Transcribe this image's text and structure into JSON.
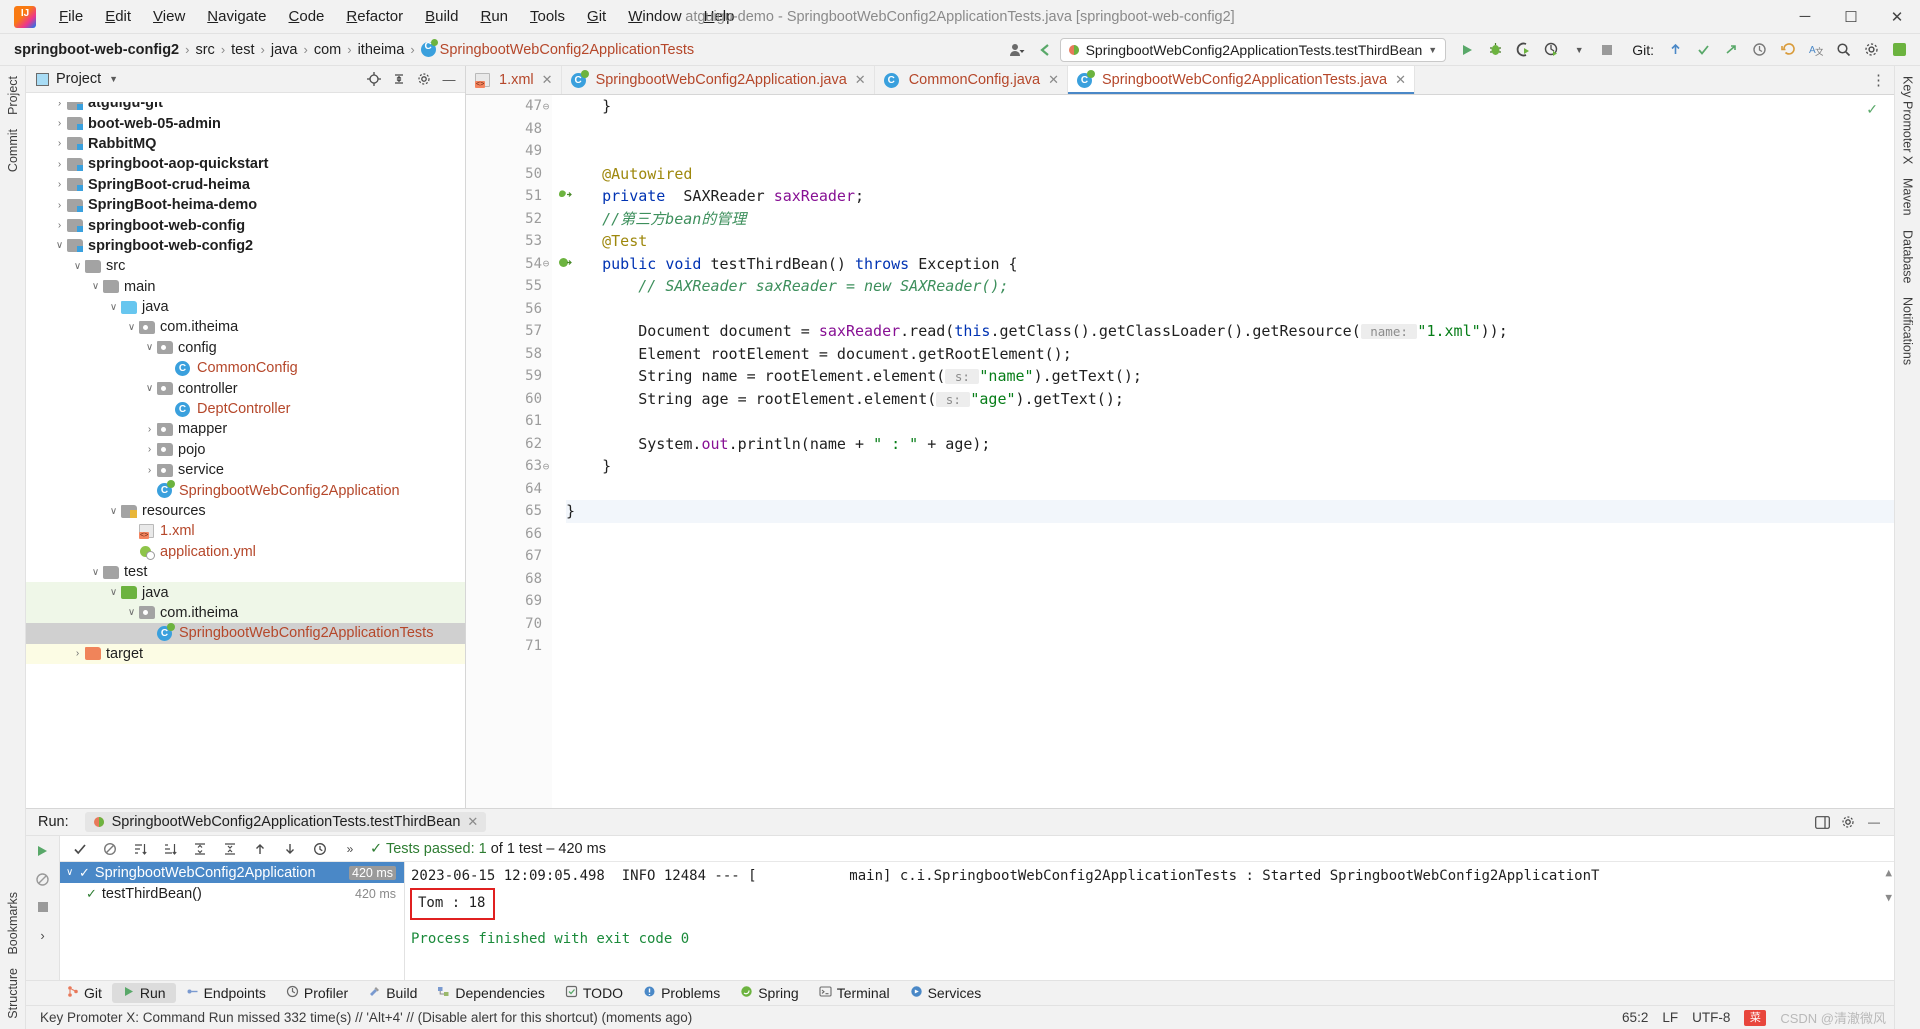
{
  "titlebar": {
    "window_title": "atguigu-demo - SpringbootWebConfig2ApplicationTests.java [springboot-web-config2]",
    "menus": [
      "File",
      "Edit",
      "View",
      "Navigate",
      "Code",
      "Refactor",
      "Build",
      "Run",
      "Tools",
      "Git",
      "Window",
      "Help"
    ],
    "minimize": "─",
    "maximize": "☐",
    "close": "✕"
  },
  "navbar": {
    "breadcrumb": [
      "springboot-web-config2",
      "src",
      "test",
      "java",
      "com",
      "itheima",
      "SpringbootWebConfig2ApplicationTests"
    ],
    "separator": "›",
    "run_config": "SpringbootWebConfig2ApplicationTests.testThirdBean",
    "git_label": "Git:",
    "icons": {
      "avatar": "user-icon",
      "back": "back-arrow-icon",
      "run": "run-icon",
      "debug": "debug-icon",
      "run_coverage": "run-with-coverage-icon",
      "profiler": "profiler-icon",
      "stop": "stop-icon",
      "update": "git-update-icon",
      "commit": "git-commit-icon",
      "push": "git-push-icon",
      "history": "history-icon",
      "rollback": "rollback-icon",
      "translate": "translate-icon",
      "search": "search-icon",
      "settings": "settings-icon",
      "ide": "ide-icon"
    }
  },
  "left_tool_strip": {
    "top": [
      "Project",
      "Commit"
    ],
    "bottom": [
      "Bookmarks",
      "Structure"
    ]
  },
  "right_tool_strip": {
    "top": [
      "Key Promoter X",
      "Maven",
      "Database",
      "Notifications"
    ]
  },
  "project_panel": {
    "title": "Project",
    "tree": [
      {
        "label": "atguigu-git",
        "depth": 1,
        "arrow": "›",
        "icon": "module",
        "bold": true,
        "clipped": true
      },
      {
        "label": "boot-web-05-admin",
        "depth": 1,
        "arrow": "›",
        "icon": "module",
        "bold": true
      },
      {
        "label": "RabbitMQ",
        "depth": 1,
        "arrow": "›",
        "icon": "module",
        "bold": true
      },
      {
        "label": "springboot-aop-quickstart",
        "depth": 1,
        "arrow": "›",
        "icon": "module",
        "bold": true
      },
      {
        "label": "SpringBoot-crud-heima",
        "depth": 1,
        "arrow": "›",
        "icon": "module",
        "bold": true
      },
      {
        "label": "SpringBoot-heima-demo",
        "depth": 1,
        "arrow": "›",
        "icon": "module",
        "bold": true
      },
      {
        "label": "springboot-web-config",
        "depth": 1,
        "arrow": "›",
        "icon": "module",
        "bold": true
      },
      {
        "label": "springboot-web-config2",
        "depth": 1,
        "arrow": "∨",
        "icon": "module",
        "bold": true
      },
      {
        "label": "src",
        "depth": 2,
        "arrow": "∨",
        "icon": "folder"
      },
      {
        "label": "main",
        "depth": 3,
        "arrow": "∨",
        "icon": "folder"
      },
      {
        "label": "java",
        "depth": 4,
        "arrow": "∨",
        "icon": "src-java"
      },
      {
        "label": "com.itheima",
        "depth": 5,
        "arrow": "∨",
        "icon": "package"
      },
      {
        "label": "config",
        "depth": 6,
        "arrow": "∨",
        "icon": "package"
      },
      {
        "label": "CommonConfig",
        "depth": 7,
        "arrow": "",
        "icon": "class",
        "orange": true
      },
      {
        "label": "controller",
        "depth": 6,
        "arrow": "∨",
        "icon": "package"
      },
      {
        "label": "DeptController",
        "depth": 7,
        "arrow": "",
        "icon": "class",
        "orange": true
      },
      {
        "label": "mapper",
        "depth": 6,
        "arrow": "›",
        "icon": "package"
      },
      {
        "label": "pojo",
        "depth": 6,
        "arrow": "›",
        "icon": "package"
      },
      {
        "label": "service",
        "depth": 6,
        "arrow": "›",
        "icon": "package"
      },
      {
        "label": "SpringbootWebConfig2Application",
        "depth": 6,
        "arrow": "",
        "icon": "spring-class",
        "orange": true
      },
      {
        "label": "resources",
        "depth": 4,
        "arrow": "∨",
        "icon": "resources"
      },
      {
        "label": "1.xml",
        "depth": 5,
        "arrow": "",
        "icon": "xml",
        "orange": true
      },
      {
        "label": "application.yml",
        "depth": 5,
        "arrow": "",
        "icon": "yml",
        "orange": true
      },
      {
        "label": "test",
        "depth": 3,
        "arrow": "∨",
        "icon": "folder"
      },
      {
        "label": "java",
        "depth": 4,
        "arrow": "∨",
        "icon": "test-java",
        "row": "greenish"
      },
      {
        "label": "com.itheima",
        "depth": 5,
        "arrow": "∨",
        "icon": "package",
        "row": "greenish"
      },
      {
        "label": "SpringbootWebConfig2ApplicationTests",
        "depth": 6,
        "arrow": "",
        "icon": "spring-class",
        "orange": true,
        "row": "selected"
      },
      {
        "label": "target",
        "depth": 2,
        "arrow": "›",
        "icon": "target",
        "row": "yellowish"
      }
    ]
  },
  "editor": {
    "tabs": [
      {
        "label": "1.xml",
        "icon": "xml-icon",
        "active": false
      },
      {
        "label": "SpringbootWebConfig2Application.java",
        "icon": "spring-class-icon",
        "active": false
      },
      {
        "label": "CommonConfig.java",
        "icon": "class-icon",
        "active": false
      },
      {
        "label": "SpringbootWebConfig2ApplicationTests.java",
        "icon": "spring-class-icon",
        "active": true
      }
    ],
    "first_line": 47,
    "lines": [
      {
        "n": 47,
        "gutter": "",
        "fold": "⊖",
        "segs": [
          {
            "t": "    }",
            "c": "typ"
          }
        ]
      },
      {
        "n": 48,
        "gutter": "",
        "fold": "",
        "segs": []
      },
      {
        "n": 49,
        "gutter": "",
        "fold": "",
        "segs": []
      },
      {
        "n": 50,
        "gutter": "",
        "fold": "",
        "segs": [
          {
            "t": "    ",
            "c": "typ"
          },
          {
            "t": "@Autowired",
            "c": "ann"
          }
        ]
      },
      {
        "n": 51,
        "gutter": "bean",
        "fold": "",
        "segs": [
          {
            "t": "    ",
            "c": "typ"
          },
          {
            "t": "private",
            "c": "kw"
          },
          {
            "t": "  SAXReader ",
            "c": "typ"
          },
          {
            "t": "saxReader",
            "c": "fld"
          },
          {
            "t": ";",
            "c": "typ"
          }
        ]
      },
      {
        "n": 52,
        "gutter": "",
        "fold": "",
        "segs": [
          {
            "t": "    ",
            "c": "typ"
          },
          {
            "t": "//第三方bean的管理",
            "c": "cmt"
          }
        ]
      },
      {
        "n": 53,
        "gutter": "",
        "fold": "",
        "segs": [
          {
            "t": "    ",
            "c": "typ"
          },
          {
            "t": "@Test",
            "c": "ann"
          }
        ]
      },
      {
        "n": 54,
        "gutter": "run",
        "fold": "⊖",
        "segs": [
          {
            "t": "    ",
            "c": "typ"
          },
          {
            "t": "public",
            "c": "kw"
          },
          {
            "t": " ",
            "c": "typ"
          },
          {
            "t": "void",
            "c": "kw"
          },
          {
            "t": " testThirdBean() ",
            "c": "typ"
          },
          {
            "t": "throws",
            "c": "kw"
          },
          {
            "t": " Exception {",
            "c": "typ"
          }
        ]
      },
      {
        "n": 55,
        "gutter": "",
        "fold": "",
        "segs": [
          {
            "t": "        ",
            "c": "typ"
          },
          {
            "t": "// SAXReader saxReader = new SAXReader();",
            "c": "cmt"
          }
        ]
      },
      {
        "n": 56,
        "gutter": "",
        "fold": "",
        "segs": []
      },
      {
        "n": 57,
        "gutter": "",
        "fold": "",
        "segs": [
          {
            "t": "        Document document = ",
            "c": "typ"
          },
          {
            "t": "saxReader",
            "c": "fld"
          },
          {
            "t": ".read(",
            "c": "typ"
          },
          {
            "t": "this",
            "c": "kw"
          },
          {
            "t": ".getClass().getClassLoader().getResource(",
            "c": "typ"
          },
          {
            "t": " name: ",
            "c": "hint"
          },
          {
            "t": "\"1.xml\"",
            "c": "str"
          },
          {
            "t": "));",
            "c": "typ"
          }
        ]
      },
      {
        "n": 58,
        "gutter": "",
        "fold": "",
        "segs": [
          {
            "t": "        Element rootElement = document.getRootElement();",
            "c": "typ"
          }
        ]
      },
      {
        "n": 59,
        "gutter": "",
        "fold": "",
        "segs": [
          {
            "t": "        String name = rootElement.element(",
            "c": "typ"
          },
          {
            "t": " s: ",
            "c": "hint"
          },
          {
            "t": "\"name\"",
            "c": "str"
          },
          {
            "t": ").getText();",
            "c": "typ"
          }
        ]
      },
      {
        "n": 60,
        "gutter": "",
        "fold": "",
        "segs": [
          {
            "t": "        String age = rootElement.element(",
            "c": "typ"
          },
          {
            "t": " s: ",
            "c": "hint"
          },
          {
            "t": "\"age\"",
            "c": "str"
          },
          {
            "t": ").getText();",
            "c": "typ"
          }
        ]
      },
      {
        "n": 61,
        "gutter": "",
        "fold": "",
        "segs": []
      },
      {
        "n": 62,
        "gutter": "",
        "fold": "",
        "segs": [
          {
            "t": "        System.",
            "c": "typ"
          },
          {
            "t": "out",
            "c": "fld"
          },
          {
            "t": ".println(name + ",
            "c": "typ"
          },
          {
            "t": "\" : \"",
            "c": "str"
          },
          {
            "t": " + age);",
            "c": "typ"
          }
        ]
      },
      {
        "n": 63,
        "gutter": "",
        "fold": "⊖",
        "segs": [
          {
            "t": "    }",
            "c": "typ"
          }
        ]
      },
      {
        "n": 64,
        "gutter": "",
        "fold": "",
        "segs": []
      },
      {
        "n": 65,
        "gutter": "",
        "fold": "",
        "segs": [
          {
            "t": "}",
            "c": "typ"
          }
        ],
        "highlight": true
      },
      {
        "n": 66,
        "gutter": "",
        "fold": "",
        "segs": []
      },
      {
        "n": 67,
        "gutter": "",
        "fold": "",
        "segs": []
      },
      {
        "n": 68,
        "gutter": "",
        "fold": "",
        "segs": []
      },
      {
        "n": 69,
        "gutter": "",
        "fold": "",
        "segs": []
      },
      {
        "n": 70,
        "gutter": "",
        "fold": "",
        "segs": []
      },
      {
        "n": 71,
        "gutter": "",
        "fold": "",
        "segs": []
      }
    ]
  },
  "run_panel": {
    "title": "Run:",
    "tab_label": "SpringbootWebConfig2ApplicationTests.testThirdBean",
    "tab_close": "✕",
    "status_prefix": "Tests passed: 1",
    "status_suffix": " of 1 test – 420 ms",
    "toolbar_icons": [
      "rerun-icon",
      "rerun-failed-icon",
      "stop-icon"
    ],
    "filter_icons": [
      "expand-all-icon",
      "collapse-all-icon",
      "sort-alpha-icon",
      "sort-duration-icon",
      "prev-test-icon",
      "next-test-icon",
      "history-icon",
      "more-icon"
    ],
    "tests": [
      {
        "label": "SpringbootWebConfig2Application",
        "duration": "420 ms",
        "selected": true,
        "icon": "test-passed-icon",
        "expand": "∨"
      },
      {
        "label": "testThirdBean()",
        "duration": "420 ms",
        "selected": false,
        "icon": "test-passed-icon",
        "expand": ""
      }
    ],
    "console": {
      "log_line": "2023-06-15 12:09:05.498  INFO 12484 --- [           main] c.i.SpringbootWebConfig2ApplicationTests : Started SpringbootWebConfig2ApplicationT",
      "highlighted_output": "Tom : 18",
      "exit_line": "Process finished with exit code 0"
    }
  },
  "bottom_tools": [
    {
      "label": "Git",
      "icon": "git-icon"
    },
    {
      "label": "Run",
      "icon": "run-icon",
      "active": true
    },
    {
      "label": "Endpoints",
      "icon": "endpoints-icon"
    },
    {
      "label": "Profiler",
      "icon": "profiler-icon"
    },
    {
      "label": "Build",
      "icon": "build-icon"
    },
    {
      "label": "Dependencies",
      "icon": "dependencies-icon"
    },
    {
      "label": "TODO",
      "icon": "todo-icon"
    },
    {
      "label": "Problems",
      "icon": "problems-icon"
    },
    {
      "label": "Spring",
      "icon": "spring-icon"
    },
    {
      "label": "Terminal",
      "icon": "terminal-icon"
    },
    {
      "label": "Services",
      "icon": "services-icon"
    }
  ],
  "statusbar": {
    "message": "Key Promoter X: Command Run missed 332 time(s) // 'Alt+4' // (Disable alert for this shortcut) (moments ago)",
    "caret": "65:2",
    "line_sep": "LF",
    "encoding": "UTF-8",
    "watermark": "CSDN @清澈微风"
  },
  "colors": {
    "accent": "#4a88c7",
    "green": "#59a869",
    "orange_text": "#b5472a",
    "red_box": "#e02020",
    "console_green": "#1a8a3a"
  }
}
